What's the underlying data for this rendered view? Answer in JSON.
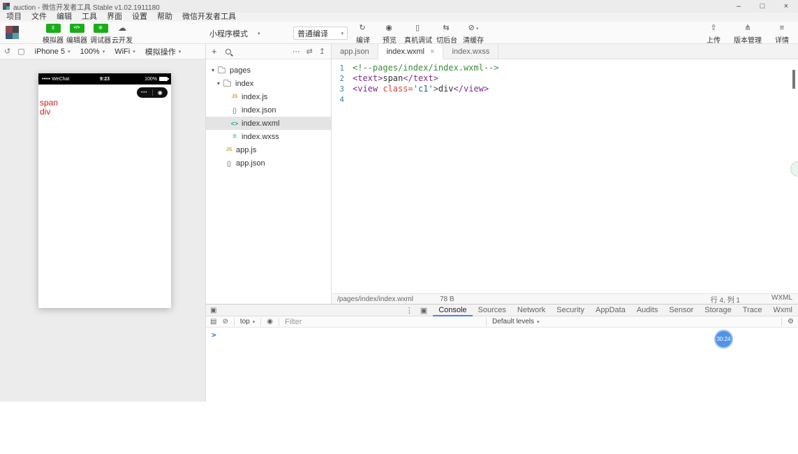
{
  "colors": {
    "green": "#1aad19",
    "badge-blue": "#5193e6",
    "accent-blue": "#4285f4",
    "phone-red": "#cf1d1d",
    "code-comment": "#3a8b3a",
    "code-tag": "#822c8e",
    "code-attr": "#d2413a",
    "code-string": "#2060a0",
    "code-text": "#333333",
    "line-number": "#3a86a8",
    "selection-bg": "#e4e4e4"
  },
  "titlebar": {
    "title": "auction - 微信开发者工具 Stable v1.02.1911180",
    "controls": {
      "minimize": "–",
      "maximize": "□",
      "close": "×"
    }
  },
  "menubar": {
    "items": [
      "项目",
      "文件",
      "编辑",
      "工具",
      "界面",
      "设置",
      "帮助",
      "微信开发者工具"
    ]
  },
  "toolbar": {
    "toggles": [
      {
        "name": "simulator",
        "label": "模拟器",
        "glyph": "▯"
      },
      {
        "name": "editor",
        "label": "编辑器",
        "glyph": "</>"
      },
      {
        "name": "debugger",
        "label": "调试器",
        "glyph": "◎"
      }
    ],
    "cloud": {
      "label": "云开发",
      "glyph": "☁"
    },
    "mode_select": {
      "label": "小程序模式"
    },
    "compile_select": {
      "label": "普通编译"
    },
    "actions": [
      {
        "name": "compile",
        "label": "编译",
        "glyph": "↻"
      },
      {
        "name": "preview",
        "label": "预览",
        "glyph": "◉"
      },
      {
        "name": "remote-debug",
        "label": "真机调试",
        "glyph": "▯"
      },
      {
        "name": "switch-background",
        "label": "切后台",
        "glyph": "⇆"
      },
      {
        "name": "clear-cache",
        "label": "清缓存",
        "glyph": "⊘",
        "caret": true
      }
    ],
    "right_actions": [
      {
        "name": "upload",
        "label": "上传",
        "glyph": "⇧"
      },
      {
        "name": "version-control",
        "label": "版本管理",
        "glyph": "⋔"
      },
      {
        "name": "details",
        "label": "详情",
        "glyph": "≡"
      }
    ]
  },
  "device_bar": {
    "dropdowns": [
      {
        "name": "device",
        "label": "iPhone 5"
      },
      {
        "name": "zoom",
        "label": "100%"
      },
      {
        "name": "network",
        "label": "WiFi"
      },
      {
        "name": "simulate-action",
        "label": "模拟操作"
      }
    ]
  },
  "simulator": {
    "status": {
      "signal": "•••••",
      "carrier": "WeChat",
      "time": "9:23",
      "battery": "100%"
    },
    "capsule": {
      "dots": "•••",
      "target": "◉"
    },
    "page_lines": [
      "span",
      "div"
    ]
  },
  "file_explorer": {
    "tree": [
      {
        "name": "pages",
        "type": "folder",
        "level": 0,
        "expanded": true
      },
      {
        "name": "index",
        "type": "folder",
        "level": 1,
        "expanded": true
      },
      {
        "name": "index.js",
        "type": "js",
        "level": 2
      },
      {
        "name": "index.json",
        "type": "json",
        "level": 2
      },
      {
        "name": "index.wxml",
        "type": "wxml",
        "level": 2,
        "selected": true
      },
      {
        "name": "index.wxss",
        "type": "wxss",
        "level": 2
      },
      {
        "name": "app.js",
        "type": "js",
        "level": 1
      },
      {
        "name": "app.json",
        "type": "json",
        "level": 1
      }
    ]
  },
  "editor": {
    "tabs": [
      {
        "label": "app.json",
        "active": false,
        "closable": false
      },
      {
        "label": "index.wxml",
        "active": true,
        "closable": true
      },
      {
        "label": "index.wxss",
        "active": false,
        "closable": false
      }
    ],
    "lines": [
      {
        "num": "1",
        "tokens": [
          {
            "t": "<!--pages/index/index.wxml-->",
            "c": "comment"
          }
        ]
      },
      {
        "num": "2",
        "tokens": [
          {
            "t": "<text>",
            "c": "tag"
          },
          {
            "t": "span",
            "c": "text"
          },
          {
            "t": "</text>",
            "c": "tag"
          }
        ]
      },
      {
        "num": "3",
        "tokens": [
          {
            "t": "<view ",
            "c": "tag"
          },
          {
            "t": "class=",
            "c": "attr"
          },
          {
            "t": "'c1'",
            "c": "string"
          },
          {
            "t": ">",
            "c": "tag"
          },
          {
            "t": "div",
            "c": "text"
          },
          {
            "t": "</view>",
            "c": "tag"
          }
        ]
      },
      {
        "num": "4",
        "tokens": []
      }
    ],
    "statusbar": {
      "path": "/pages/index/index.wxml",
      "size": "78 B",
      "position": "行 4, 列 1",
      "language": "WXML"
    }
  },
  "debugger": {
    "tabs": [
      {
        "label": "Console",
        "active": true
      },
      {
        "label": "Sources",
        "active": false
      },
      {
        "label": "Network",
        "active": false
      },
      {
        "label": "Security",
        "active": false
      },
      {
        "label": "AppData",
        "active": false
      },
      {
        "label": "Audits",
        "active": false
      },
      {
        "label": "Sensor",
        "active": false
      },
      {
        "label": "Storage",
        "active": false
      },
      {
        "label": "Trace",
        "active": false
      },
      {
        "label": "Wxml",
        "active": false
      }
    ],
    "console_toolbar": {
      "context": "top",
      "filter_placeholder": "Filter",
      "levels": "Default levels"
    },
    "prompt": ">",
    "badge": "30:24"
  }
}
